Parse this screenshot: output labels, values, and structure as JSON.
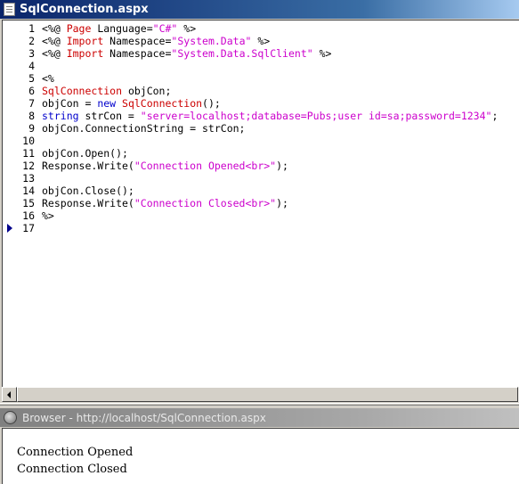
{
  "editor": {
    "title": "SqlConnection.aspx",
    "current_line": 17,
    "lines": [
      {
        "num": "1",
        "tokens": [
          {
            "t": "<%@ ",
            "c": ""
          },
          {
            "t": "Page",
            "c": "kw"
          },
          {
            "t": " Language=",
            "c": ""
          },
          {
            "t": "\"C#\"",
            "c": "str"
          },
          {
            "t": " %>",
            "c": ""
          }
        ]
      },
      {
        "num": "2",
        "tokens": [
          {
            "t": "<%@ ",
            "c": ""
          },
          {
            "t": "Import",
            "c": "kw"
          },
          {
            "t": " Namespace=",
            "c": ""
          },
          {
            "t": "\"System.Data\"",
            "c": "str"
          },
          {
            "t": " %>",
            "c": ""
          }
        ]
      },
      {
        "num": "3",
        "tokens": [
          {
            "t": "<%@ ",
            "c": ""
          },
          {
            "t": "Import",
            "c": "kw"
          },
          {
            "t": " Namespace=",
            "c": ""
          },
          {
            "t": "\"System.Data.SqlClient\"",
            "c": "str"
          },
          {
            "t": " %>",
            "c": ""
          }
        ]
      },
      {
        "num": "4",
        "tokens": []
      },
      {
        "num": "5",
        "tokens": [
          {
            "t": "<%",
            "c": ""
          }
        ]
      },
      {
        "num": "6",
        "tokens": [
          {
            "t": "SqlConnection",
            "c": "kw"
          },
          {
            "t": " objCon;",
            "c": ""
          }
        ]
      },
      {
        "num": "7",
        "tokens": [
          {
            "t": "objCon = ",
            "c": ""
          },
          {
            "t": "new",
            "c": "blue"
          },
          {
            "t": " ",
            "c": ""
          },
          {
            "t": "SqlConnection",
            "c": "kw"
          },
          {
            "t": "();",
            "c": ""
          }
        ]
      },
      {
        "num": "8",
        "tokens": [
          {
            "t": "string",
            "c": "blue"
          },
          {
            "t": " strCon = ",
            "c": ""
          },
          {
            "t": "\"server=localhost;database=Pubs;user id=sa;password=1234\"",
            "c": "str"
          },
          {
            "t": ";",
            "c": ""
          }
        ]
      },
      {
        "num": "9",
        "tokens": [
          {
            "t": "objCon.ConnectionString = strCon;",
            "c": ""
          }
        ]
      },
      {
        "num": "10",
        "tokens": []
      },
      {
        "num": "11",
        "tokens": [
          {
            "t": "objCon.Open();",
            "c": ""
          }
        ]
      },
      {
        "num": "12",
        "tokens": [
          {
            "t": "Response.Write(",
            "c": ""
          },
          {
            "t": "\"Connection Opened<br>\"",
            "c": "str"
          },
          {
            "t": ");",
            "c": ""
          }
        ]
      },
      {
        "num": "13",
        "tokens": []
      },
      {
        "num": "14",
        "tokens": [
          {
            "t": "objCon.Close();",
            "c": ""
          }
        ]
      },
      {
        "num": "15",
        "tokens": [
          {
            "t": "Response.Write(",
            "c": ""
          },
          {
            "t": "\"Connection Closed<br>\"",
            "c": "str"
          },
          {
            "t": ");",
            "c": ""
          }
        ]
      },
      {
        "num": "16",
        "tokens": [
          {
            "t": "%>",
            "c": ""
          }
        ]
      },
      {
        "num": "17",
        "tokens": []
      }
    ]
  },
  "browser": {
    "title": "Browser - http://localhost/SqlConnection.aspx",
    "output": [
      "Connection Opened",
      "Connection Closed"
    ]
  },
  "colors": {
    "keyword": "#cc0000",
    "builtin": "#0000cc",
    "string": "#cc00cc",
    "active_title": "#0a246a",
    "inactive_title": "#808080"
  },
  "icons": {
    "editor_window": "document-icon",
    "browser_window": "globe-icon",
    "current_line_marker": "current-line-arrow-icon",
    "scroll_left": "arrow-left-icon"
  }
}
